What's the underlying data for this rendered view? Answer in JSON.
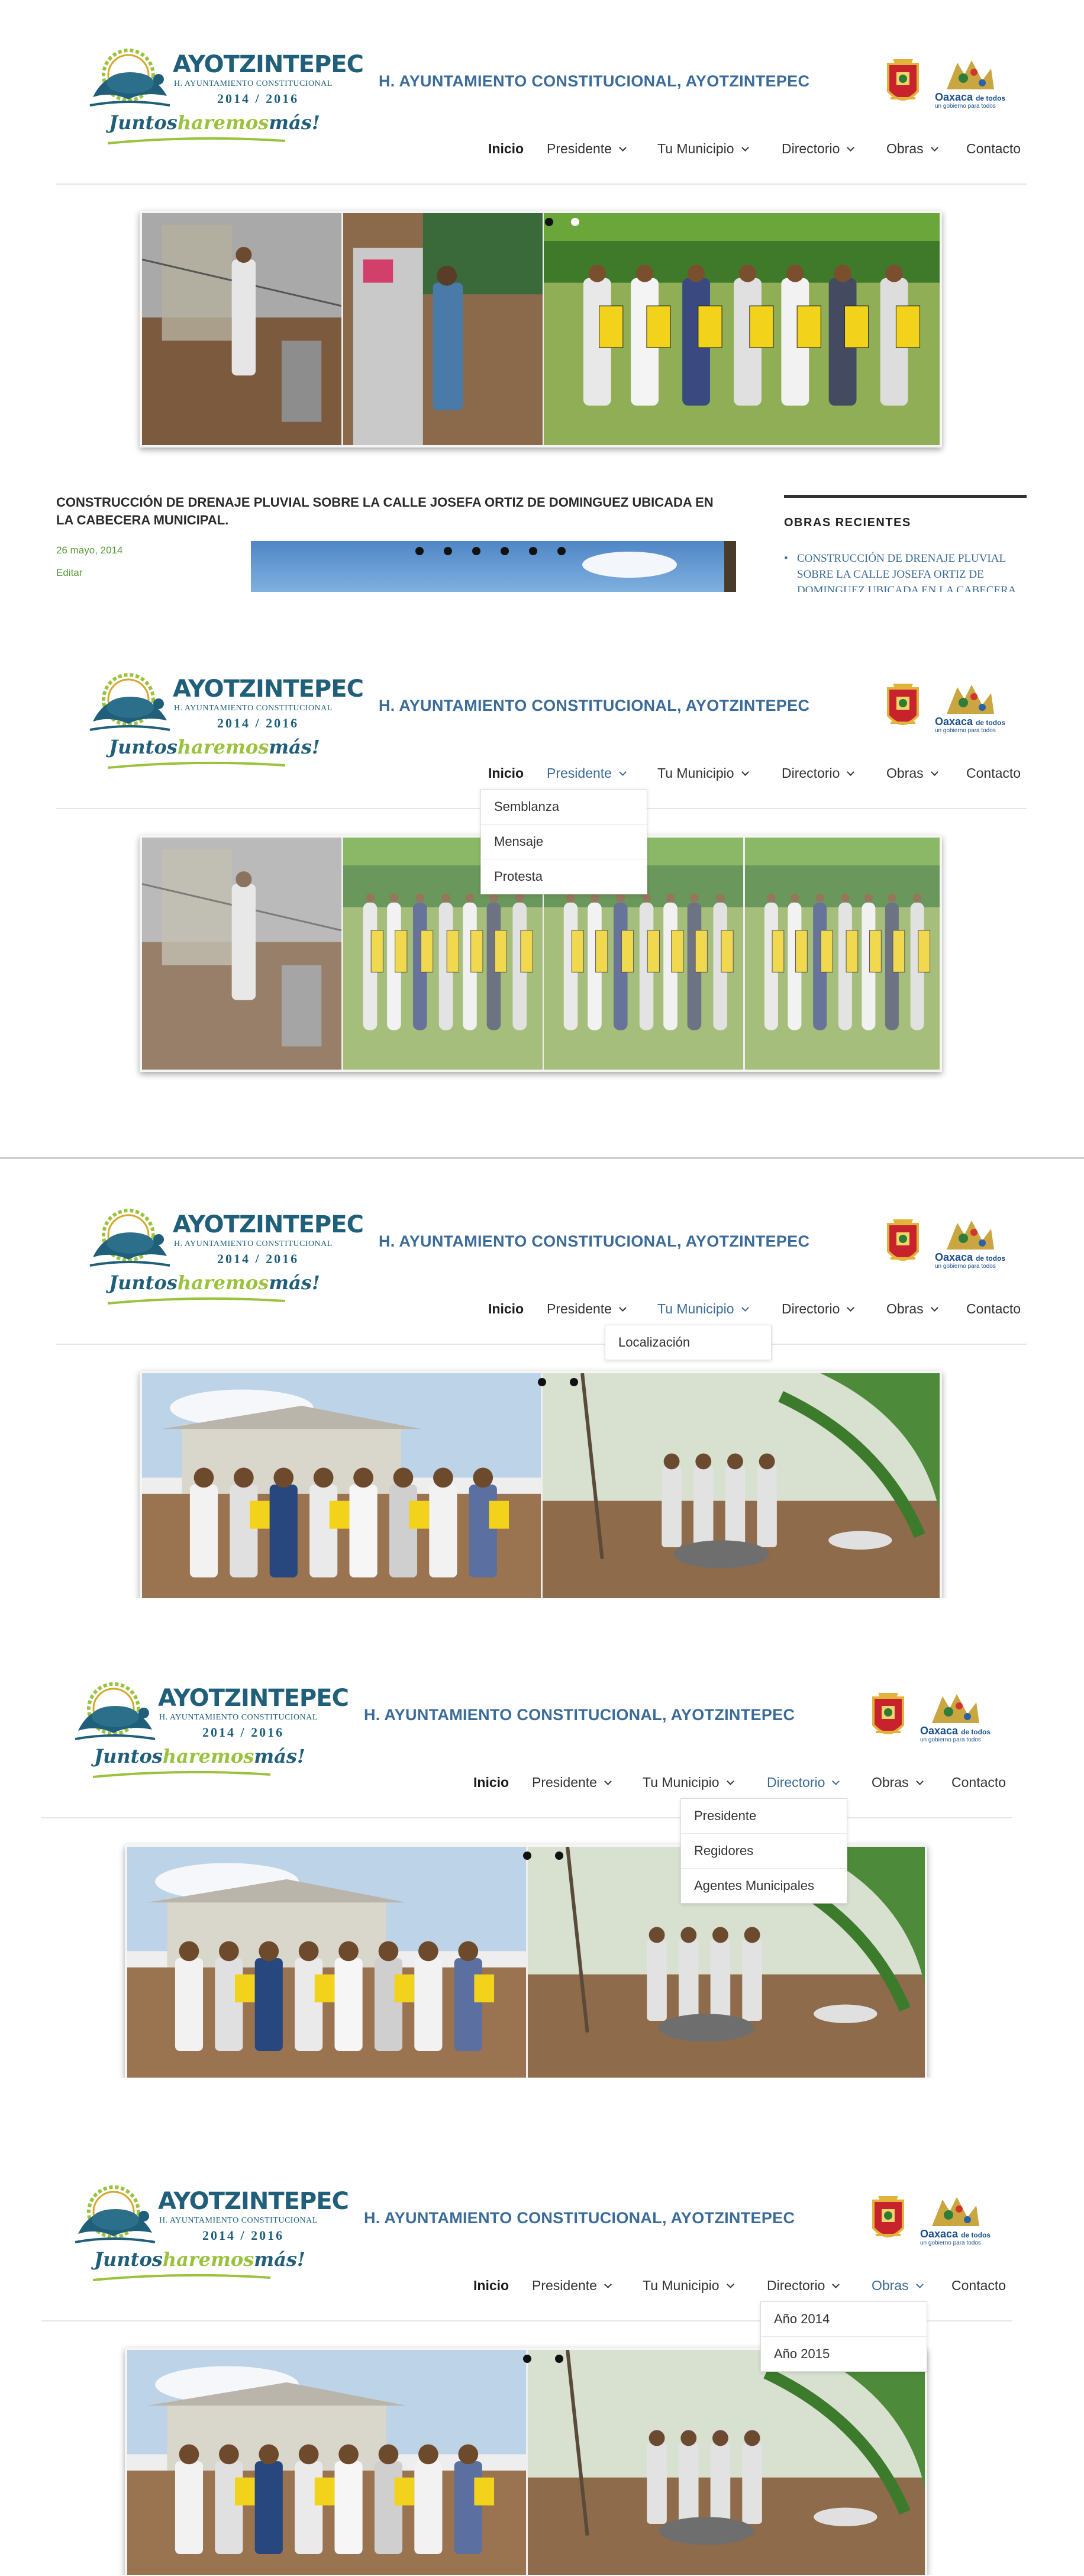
{
  "site": {
    "brand": "AYOTZINTEPEC",
    "brand_sub": "H. AYUNTAMIENTO CONSTITUCIONAL",
    "years": "2014 / 2016",
    "slogan_1": "Juntos",
    "slogan_2": "haremos",
    "slogan_3": "más!",
    "title": "H. AYUNTAMIENTO CONSTITUCIONAL, AYOTZINTEPEC",
    "oaxaca_label": "Oaxaca",
    "oaxaca_suffix": "de todos",
    "oaxaca_tagline": "un gobierno para todos"
  },
  "nav": {
    "inicio": "Inicio",
    "presidente": "Presidente",
    "tu_municipio": "Tu Municipio",
    "directorio": "Directorio",
    "obras": "Obras",
    "contacto": "Contacto"
  },
  "menus": {
    "presidente": [
      "Semblanza",
      "Mensaje",
      "Protesta"
    ],
    "tu_municipio": [
      "Localización"
    ],
    "directorio": [
      "Presidente",
      "Regidores",
      "Agentes Municipales"
    ],
    "obras": [
      "Año 2014",
      "Año 2015"
    ]
  },
  "post": {
    "title": "CONSTRUCCIÓN DE DRENAJE PLUVIAL SOBRE LA CALLE JOSEFA ORTIZ DE DOMINGUEZ UBICADA EN LA CABECERA MUNICIPAL.",
    "date": "26 mayo, 2014",
    "edit": "Editar"
  },
  "sidebar": {
    "title": "OBRAS RECIENTES",
    "link": "CONSTRUCCIÓN DE DRENAJE PLUVIAL SOBRE LA CALLE JOSEFA ORTIZ DE DOMINGUEZ UBICADA EN LA CABECERA"
  },
  "colors": {
    "brand_teal": "#1f5f7a",
    "brand_green": "#9bc23c",
    "title_blue": "#3b6b98",
    "date_green": "#5a9a3a"
  },
  "icons": [
    "turtle-logo-icon",
    "municipal-seal-icon",
    "oaxaca-emblem-icon",
    "chevron-down-icon"
  ]
}
